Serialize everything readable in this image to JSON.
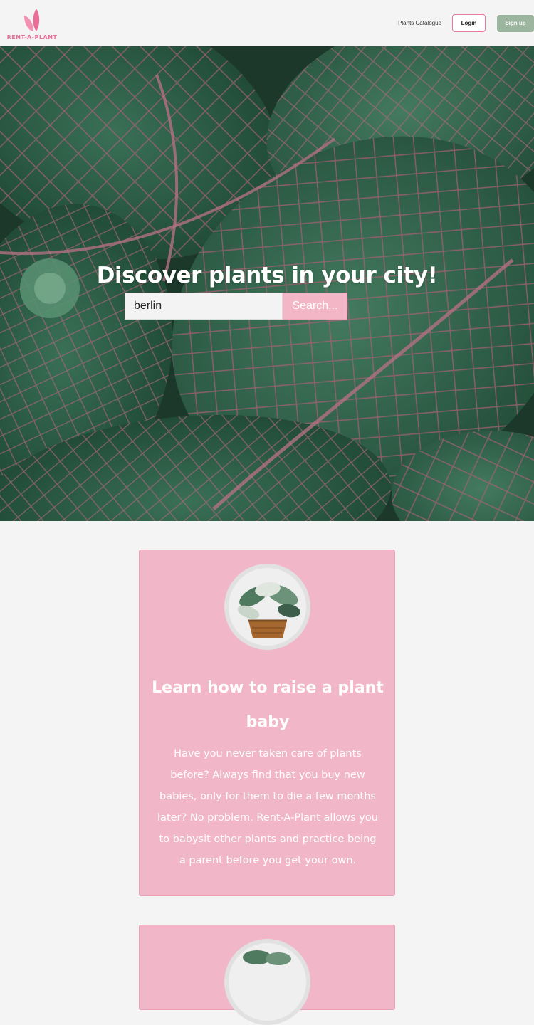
{
  "brand": {
    "name": "RENT-A-PLANT",
    "accent_color": "#ea6d98",
    "logo_icon": "sprout-leaves-icon"
  },
  "nav": {
    "catalogue_label": "Plants Catalogue",
    "login_label": "Login",
    "signup_label": "Sign up"
  },
  "hero": {
    "title": "Discover plants in your city!",
    "search_value": "berlin",
    "search_button_label": "Search..."
  },
  "cards": [
    {
      "title": "Learn how to raise a plant baby",
      "body": "Have you never taken care of plants before? Always find that you buy new babies, only for them to die a few months later? No problem. Rent-A-Plant allows you to babysit other plants and practice being a parent before you get your own.",
      "image_icon": "potted-plant-icon"
    },
    {
      "image_icon": "potted-plant-icon"
    }
  ],
  "colors": {
    "card_background": "#f1b6c7",
    "signup_button": "#9bb59e",
    "page_background": "#f4f4f4"
  }
}
